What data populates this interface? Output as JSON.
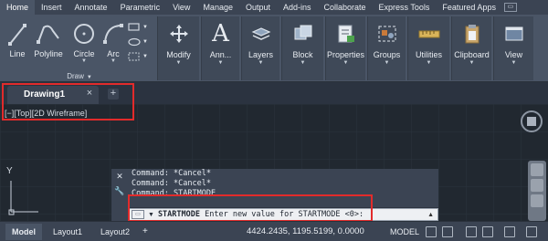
{
  "menu": {
    "tabs": [
      "Home",
      "Insert",
      "Annotate",
      "Parametric",
      "View",
      "Manage",
      "Output",
      "Add-ins",
      "Collaborate",
      "Express Tools",
      "Featured Apps"
    ],
    "active": "Home"
  },
  "ribbon": {
    "draw": {
      "line": "Line",
      "polyline": "Polyline",
      "circle": "Circle",
      "arc": "Arc",
      "footer": "Draw"
    },
    "buttons": {
      "modify": "Modify",
      "annotation": "Ann...",
      "layers": "Layers",
      "block": "Block",
      "properties": "Properties",
      "groups": "Groups",
      "utilities": "Utilities",
      "clipboard": "Clipboard",
      "view": "View"
    }
  },
  "document": {
    "tab_title": "Drawing1",
    "close_glyph": "×",
    "add_glyph": "+"
  },
  "viewport": {
    "label": "[−][Top][2D Wireframe]",
    "axis_y": "Y"
  },
  "command": {
    "history": [
      "Command: *Cancel*",
      "Command: *Cancel*",
      "Command: STARTMODE"
    ],
    "input_command": "STARTMODE",
    "input_prompt": "Enter new value for STARTMODE <0>:"
  },
  "status": {
    "tabs": [
      "Model",
      "Layout1",
      "Layout2"
    ],
    "add_glyph": "+",
    "coordinates": "4424.2435, 1195.5199, 0.0000",
    "model_label": "MODEL"
  },
  "colors": {
    "highlight": "#e22b2b",
    "ribbon": "#4a5566",
    "canvas": "#212830"
  }
}
